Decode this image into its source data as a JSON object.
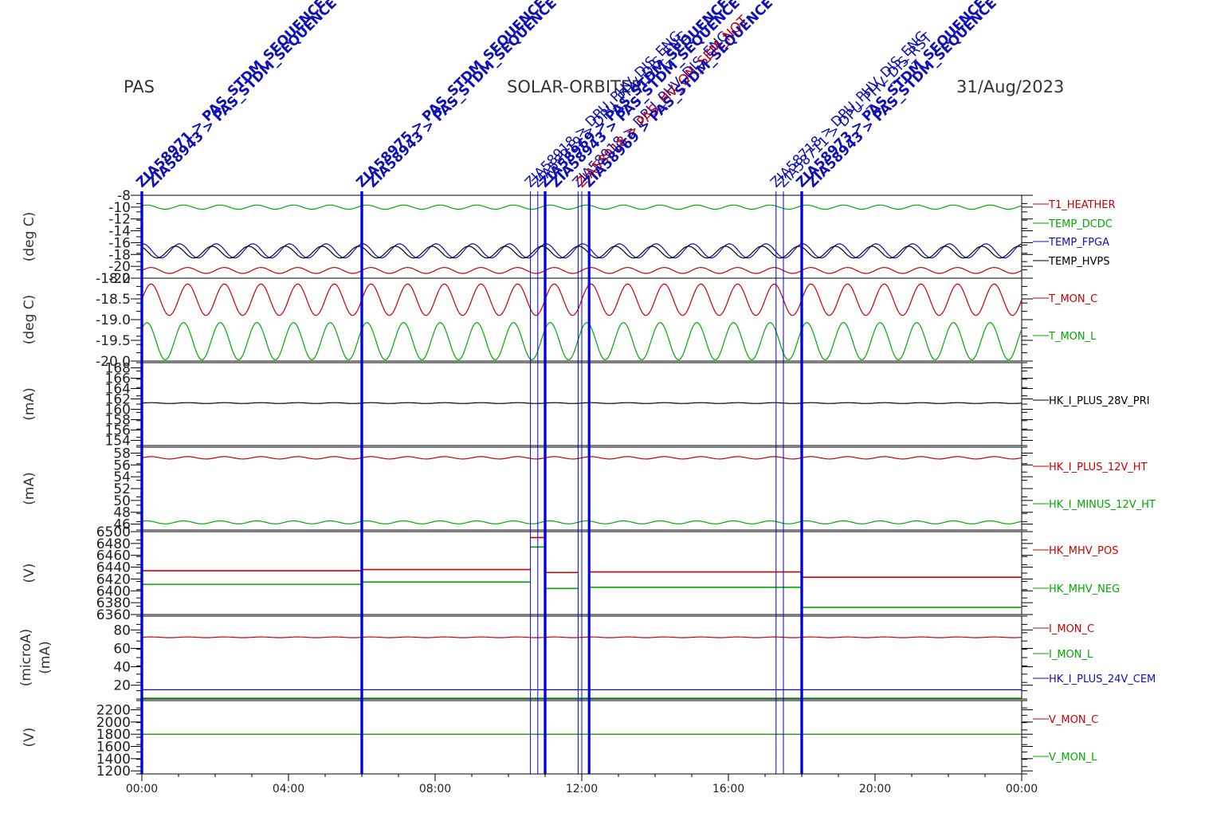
{
  "header": {
    "left": "PAS",
    "center": "SOLAR-ORBITER",
    "right": "31/Aug/2023"
  },
  "x_ticks": [
    "00:00",
    "04:00",
    "08:00",
    "12:00",
    "16:00",
    "20:00",
    "00:00"
  ],
  "colors": {
    "red": "#cc0000",
    "green": "#00aa00",
    "blue": "#1010b8",
    "black": "#000000",
    "marker": "#0000dd"
  },
  "chart_data": [
    {
      "type": "line",
      "ylabel": "(deg C)",
      "ylim": [
        -22,
        -8
      ],
      "yticks": [
        -8,
        -10,
        -12,
        -14,
        -16,
        -18,
        -20,
        -22
      ],
      "series": [
        {
          "name": "T1_HEATHER",
          "color": "red",
          "base": -20.7,
          "amp": 0.5,
          "periods": 24
        },
        {
          "name": "TEMP_DCDC",
          "color": "green",
          "base": -10,
          "amp": 0.35,
          "periods": 24
        },
        {
          "name": "TEMP_FPGA",
          "color": "blue",
          "base": -17.4,
          "amp": 1.2,
          "periods": 24
        },
        {
          "name": "TEMP_HVPS",
          "color": "black",
          "base": -17.6,
          "amp": 1.0,
          "periods": 24
        }
      ]
    },
    {
      "type": "line",
      "ylabel": "(deg C)",
      "ylim": [
        -20.0,
        -18.0
      ],
      "yticks": [
        -18.0,
        -18.5,
        -19.0,
        -19.5,
        -20.0
      ],
      "ytick_labels": [
        "-18.0",
        "-18.5",
        "-19.0",
        "-19.5",
        "-20.0"
      ],
      "series": [
        {
          "name": "T_MON_C",
          "color": "red",
          "base": -18.52,
          "amp": 0.38,
          "periods": 24
        },
        {
          "name": "T_MON_L",
          "color": "green",
          "base": -19.52,
          "amp": 0.45,
          "periods": 24
        }
      ]
    },
    {
      "type": "line",
      "ylabel": "(mA)",
      "ylim": [
        153,
        169
      ],
      "yticks": [
        154,
        156,
        158,
        160,
        162,
        164,
        166,
        168
      ],
      "series": [
        {
          "name": "HK_I_PLUS_28V_PRI",
          "color": "black",
          "base": 161.2,
          "amp": 0.08,
          "periods": 24
        }
      ]
    },
    {
      "type": "line",
      "ylabel": "(mA)",
      "ylim": [
        45,
        59
      ],
      "yticks": [
        46,
        48,
        50,
        52,
        54,
        56,
        58
      ],
      "series": [
        {
          "name": "HK_I_PLUS_12V_HT",
          "color": "red",
          "base": 57.2,
          "amp": 0.2,
          "periods": 24
        },
        {
          "name": "HK_I_MINUS_12V_HT",
          "color": "green",
          "base": 46.3,
          "amp": 0.25,
          "periods": 24
        }
      ]
    },
    {
      "type": "line",
      "ylabel": "(V)",
      "ylim": [
        6360,
        6500
      ],
      "yticks": [
        6500,
        6480,
        6460,
        6440,
        6420,
        6400,
        6380,
        6360
      ],
      "ytick_labels": [
        "6500",
        "6480",
        "6460",
        "6440",
        "6420",
        "6400",
        "6380",
        "6360"
      ],
      "series": [
        {
          "name": "HK_MHV_POS",
          "color": "red",
          "steps": [
            [
              0,
              6.0,
              6434
            ],
            [
              6.0,
              10.6,
              6436
            ],
            [
              10.6,
              11.0,
              6490
            ],
            [
              11.0,
              11.9,
              6431
            ],
            [
              12.2,
              18.0,
              6432
            ],
            [
              18.0,
              24,
              6423
            ]
          ]
        },
        {
          "name": "HK_MHV_NEG",
          "color": "green",
          "steps": [
            [
              0,
              6.0,
              6411
            ],
            [
              6.0,
              10.6,
              6415
            ],
            [
              10.6,
              11.0,
              6474
            ],
            [
              11.0,
              11.9,
              6404
            ],
            [
              12.2,
              18.0,
              6406
            ],
            [
              18.0,
              24,
              6372
            ]
          ]
        }
      ]
    },
    {
      "type": "line",
      "ylabel": "(microA)",
      "ylabel2": "(mA)",
      "ylim": [
        5,
        95
      ],
      "yticks": [
        20,
        40,
        60,
        80
      ],
      "series": [
        {
          "name": "I_MON_C",
          "color": "red",
          "base": 72,
          "amp": 0.4,
          "periods": 24
        },
        {
          "name": "I_MON_L",
          "color": "green",
          "base": 6,
          "amp": 0,
          "periods": 24
        },
        {
          "name": "HK_I_PLUS_24V_CEM",
          "color": "blue",
          "base": 15,
          "amp": 0,
          "periods": 24
        }
      ]
    },
    {
      "type": "line",
      "ylabel": "(V)",
      "ylim": [
        1150,
        2350
      ],
      "yticks": [
        1200,
        1400,
        1600,
        1800,
        2000,
        2200
      ],
      "series": [
        {
          "name": "V_MON_C",
          "color": "red",
          "base": 1800,
          "amp": 0,
          "periods": 24
        },
        {
          "name": "V_MON_L",
          "color": "green",
          "base": 1800,
          "amp": 0,
          "periods": 24
        }
      ]
    }
  ],
  "event_markers": [
    {
      "hour": 0.0,
      "label": "ZIA58971 > PAS_STDM_SEQUENCE",
      "thick": true,
      "color": "blue"
    },
    {
      "hour": 0.0,
      "label": "ZIA58943 > PAS_STDM_SEQUENCE",
      "thick": true,
      "color": "blue"
    },
    {
      "hour": 6.0,
      "label": "ZIA58975 > PAS_STDM_SEQUENCE",
      "thick": true,
      "color": "blue"
    },
    {
      "hour": 6.0,
      "label": "ZIA58943 > PAS_STDM_SEQUENCE",
      "thick": true,
      "color": "blue"
    },
    {
      "hour": 10.6,
      "label": "ZIA58918 > DPU_PHV_DIS_ENG",
      "thick": false,
      "color": "blue"
    },
    {
      "hour": 10.8,
      "label": "ZIA58919 > DPU_PHV_DIS_ENG",
      "thick": false,
      "color": "blue"
    },
    {
      "hour": 11.0,
      "label": "ZIA58969 > PAS_STDM_SEQUENCE",
      "thick": true,
      "color": "blue"
    },
    {
      "hour": 11.0,
      "label": "ZIA58943 > PAS_STDM_SEQUENCE",
      "thick": true,
      "color": "blue"
    },
    {
      "hour": 11.9,
      "label": "ZIA58918 > DPU_PHV_DIS_ENG",
      "thick": false,
      "color": "blue"
    },
    {
      "hour": 12.0,
      "label": "ZIA58918 > PAS_HV_ON_SEM_NOT",
      "thick": false,
      "color": "red"
    },
    {
      "hour": 12.2,
      "label": "ZIA58969 > PAS_STDM_SEQUENCE",
      "thick": true,
      "color": "blue"
    },
    {
      "hour": 17.3,
      "label": "ZIA58718 > DPU_PHV_DIS_ENG",
      "thick": false,
      "color": "blue"
    },
    {
      "hour": 17.5,
      "label": "ZIA58711 > DPU_PHV_DIS_RST",
      "thick": false,
      "color": "blue"
    },
    {
      "hour": 18.0,
      "label": "ZIA58973 > PAS_STDM_SEQUENCE",
      "thick": true,
      "color": "blue"
    },
    {
      "hour": 18.0,
      "label": "ZIA58943 > PAS_STDM_SEQUENCE",
      "thick": true,
      "color": "blue"
    }
  ]
}
